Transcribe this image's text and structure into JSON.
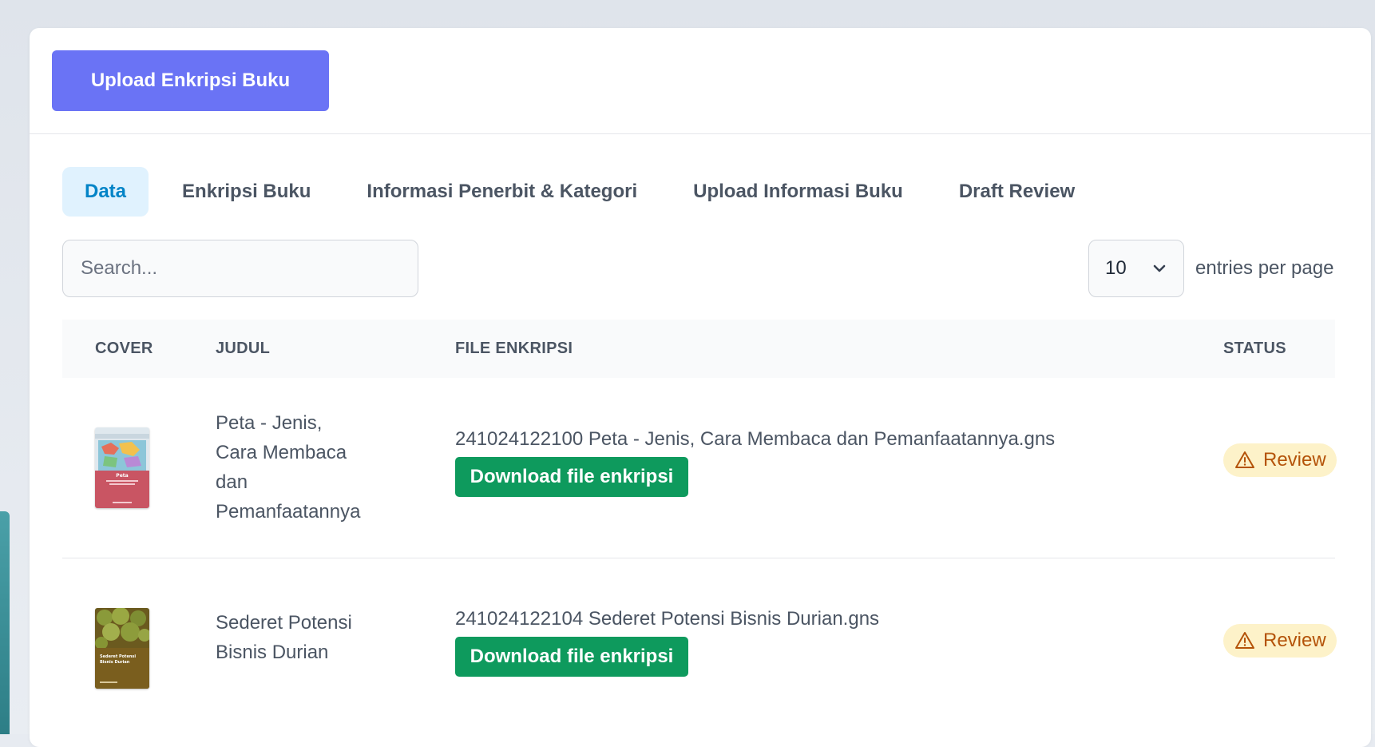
{
  "header": {
    "upload_button": "Upload Enkripsi Buku"
  },
  "tabs": [
    {
      "label": "Data",
      "active": true
    },
    {
      "label": "Enkripsi Buku",
      "active": false
    },
    {
      "label": "Informasi Penerbit & Kategori",
      "active": false
    },
    {
      "label": "Upload Informasi Buku",
      "active": false
    },
    {
      "label": "Draft Review",
      "active": false
    }
  ],
  "search": {
    "placeholder": "Search...",
    "value": ""
  },
  "pagination": {
    "per_page": "10",
    "per_page_label": "entries per page"
  },
  "table": {
    "columns": [
      "COVER",
      "JUDUL",
      "FILE ENKRIPSI",
      "STATUS"
    ],
    "rows": [
      {
        "cover_title": "Peta",
        "judul": "Peta - Jenis, Cara Membaca dan Pemanfaatannya",
        "file": "241024122100 Peta - Jenis, Cara Membaca dan Pemanfaatannya.gns",
        "download_label": "Download file enkripsi",
        "status": "Review"
      },
      {
        "cover_title": "Sederet Potensi Bisnis Durian",
        "judul": "Sederet Potensi Bisnis Durian",
        "file": "241024122104 Sederet Potensi Bisnis Durian.gns",
        "download_label": "Download file enkripsi",
        "status": "Review"
      }
    ]
  },
  "colors": {
    "primary": "#6a73f5",
    "download": "#0e9a5d",
    "tab_active_bg": "#e0f2fe",
    "tab_active_text": "#0284c7",
    "badge_bg": "#fdf2c9",
    "badge_text": "#b45309"
  },
  "icons": {
    "select": "chevron-down-icon",
    "status": "warning-triangle-icon"
  }
}
